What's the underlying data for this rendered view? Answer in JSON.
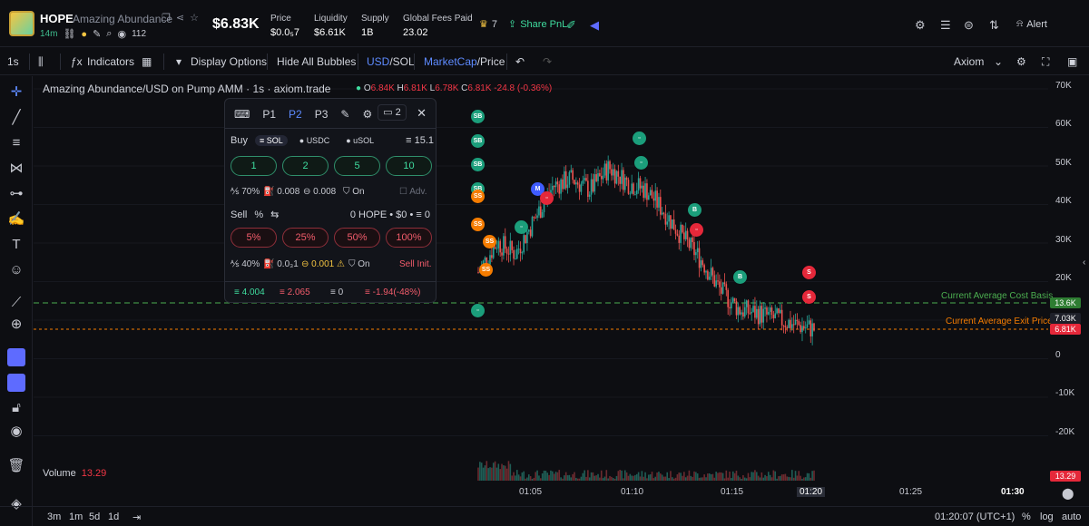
{
  "header": {
    "ticker": "HOPE",
    "full_name": "Amazing Abundance",
    "age": "14m",
    "holders_icon_count": "112",
    "price_big": "$6.83K",
    "stats": [
      {
        "label": "Price",
        "value": "$0.0₅7"
      },
      {
        "label": "Liquidity",
        "value": "$6.61K"
      },
      {
        "label": "Supply",
        "value": "1B"
      },
      {
        "label": "Global Fees Paid",
        "value": "23.02"
      }
    ],
    "crown_count": "7",
    "share_label": "Share PnL",
    "alert_label": "Alert"
  },
  "toolbar": {
    "interval": "1s",
    "indicators": "Indicators",
    "display_options": "Display Options",
    "hide_bubbles": "Hide All Bubbles",
    "usd": "USD",
    "sol": "/SOL",
    "mcap": "MarketCap",
    "price": "/Price",
    "source": "Axiom"
  },
  "legend": {
    "title": "Amazing Abundance/USD on Pump AMM · 1s · axiom.trade",
    "o": "6.84K",
    "h": "6.81K",
    "l": "6.78K",
    "c": "6.81K",
    "change": "-24.8 (-0.36%)"
  },
  "panel": {
    "tabs": [
      "P1",
      "P2",
      "P3"
    ],
    "active_tab": "P2",
    "count": "2",
    "buy_label": "Buy",
    "currencies": [
      "SOL",
      "USDC",
      "uSOL"
    ],
    "balance": "15.1",
    "buy_amounts": [
      "1",
      "2",
      "5",
      "10"
    ],
    "buy_opts": [
      "70%",
      "0.008",
      "0.008",
      "On",
      "Adv."
    ],
    "sell_label": "Sell",
    "sell_pct": "%",
    "sell_holdings": "0 HOPE • $0 •",
    "sell_sol": "0",
    "sell_amounts": [
      "5%",
      "25%",
      "50%",
      "100%"
    ],
    "sell_opts": [
      "40%",
      "0.0₃1",
      "0.001",
      "On",
      "Sell Init."
    ],
    "footer": [
      "4.004",
      "2.065",
      "0",
      "-1.94(-48%)"
    ]
  },
  "yaxis": [
    "70K",
    "60K",
    "50K",
    "40K",
    "30K",
    "20K",
    "10K",
    "0",
    "-10K",
    "-20K"
  ],
  "ytags": {
    "cost": "13.6K",
    "price": "7.03K",
    "exit": "6.81K",
    "vol": "13.29"
  },
  "lines": {
    "cost": "Current Average Cost Basis",
    "exit": "Current Average Exit Price"
  },
  "xaxis": [
    "01:05",
    "01:10",
    "01:15",
    "01:20",
    "01:25",
    "01:30"
  ],
  "volume": {
    "label": "Volume",
    "value": "13.29"
  },
  "bottom": {
    "ranges": [
      "3m",
      "1m",
      "5d",
      "1d"
    ],
    "time": "01:20:07 (UTC+1)",
    "pct": "%",
    "log": "log",
    "auto": "auto"
  },
  "colors": {
    "up": "#26a69a",
    "down": "#ef5350",
    "accent": "#5e6bff",
    "cost": "#4caf50",
    "exit": "#f57c00"
  },
  "chart_data": {
    "type": "line",
    "ylim": [
      -25000,
      72000
    ],
    "x": [
      "01:02",
      "01:03",
      "01:04",
      "01:05",
      "01:06",
      "01:07",
      "01:08",
      "01:09",
      "01:10",
      "01:11",
      "01:12",
      "01:13",
      "01:14",
      "01:15",
      "01:16",
      "01:17",
      "01:18",
      "01:19",
      "01:20"
    ],
    "series": [
      {
        "values": [
          22000,
          30000,
          27000,
          36000,
          45000,
          47000,
          44000,
          50000,
          46000,
          44000,
          38000,
          31000,
          25000,
          17000,
          12000,
          11000,
          9500,
          8000,
          6800
        ]
      }
    ],
    "cost_basis": 13600,
    "exit_price": 6810
  }
}
